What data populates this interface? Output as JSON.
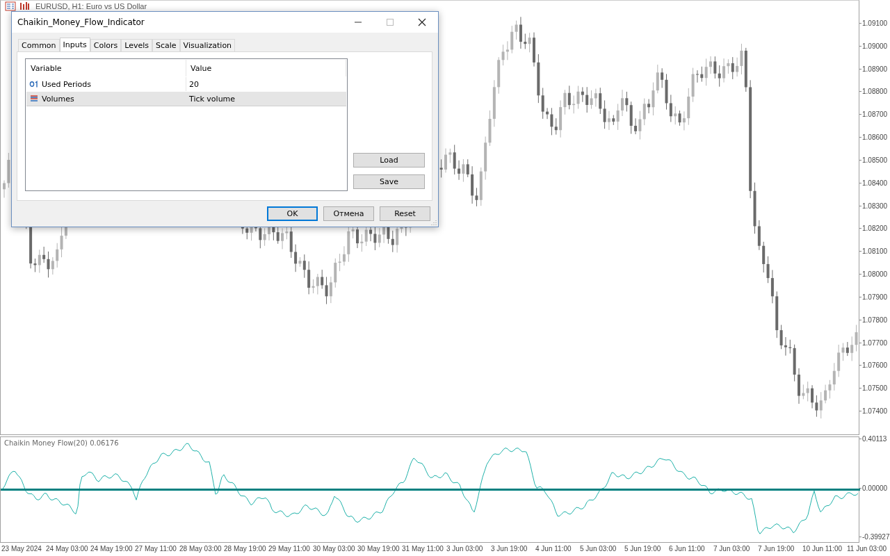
{
  "chart_window": {
    "title": "EURUSD, H1:  Euro vs US Dollar",
    "price_axis": [
      "1.09100",
      "1.09000",
      "1.08900",
      "1.08800",
      "1.08700",
      "1.08600",
      "1.08500",
      "1.08400",
      "1.08300",
      "1.08200",
      "1.08100",
      "1.08000",
      "1.07900",
      "1.07800",
      "1.07700",
      "1.07600",
      "1.07500",
      "1.07400"
    ],
    "indicator": {
      "label": "Chaikin Money Flow(20) 0.06176",
      "axis": [
        "0.40113",
        "0.00000",
        "-0.39927"
      ]
    },
    "time_axis": [
      "23 May 2024",
      "24 May 03:00",
      "24 May 19:00",
      "27 May 11:00",
      "28 May 03:00",
      "28 May 19:00",
      "29 May 11:00",
      "30 May 03:00",
      "30 May 19:00",
      "31 May 11:00",
      "3 Jun 03:00",
      "3 Jun 19:00",
      "4 Jun 11:00",
      "5 Jun 03:00",
      "5 Jun 19:00",
      "6 Jun 11:00",
      "7 Jun 03:00",
      "7 Jun 19:00",
      "10 Jun 11:00",
      "11 Jun 03:00"
    ]
  },
  "dialog": {
    "title": "Chaikin_Money_Flow_Indicator",
    "tabs": [
      {
        "label": "Common",
        "selected": false
      },
      {
        "label": "Inputs",
        "selected": true
      },
      {
        "label": "Colors",
        "selected": false
      },
      {
        "label": "Levels",
        "selected": false
      },
      {
        "label": "Scale",
        "selected": false
      },
      {
        "label": "Visualization",
        "selected": false
      }
    ],
    "table": {
      "columns": [
        "Variable",
        "Value"
      ],
      "rows": [
        {
          "kind": "int",
          "variable": "Used Periods",
          "value": "20",
          "selected": false
        },
        {
          "kind": "enum",
          "variable": "Volumes",
          "value": "Tick volume",
          "selected": true
        }
      ]
    },
    "side_buttons": [
      "Load",
      "Save"
    ],
    "buttons": [
      {
        "label": "OK",
        "default": true
      },
      {
        "label": "Отмена",
        "default": false
      },
      {
        "label": "Reset",
        "default": false
      }
    ]
  }
}
